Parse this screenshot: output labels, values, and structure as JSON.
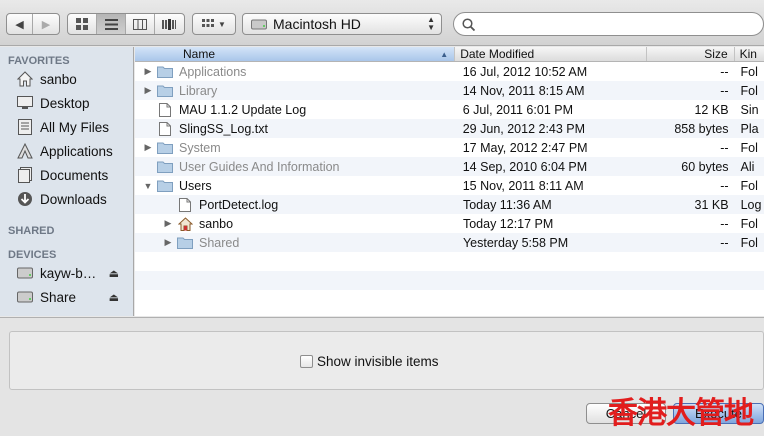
{
  "toolbar": {
    "location": "Macintosh HD",
    "search_placeholder": ""
  },
  "sidebar": {
    "favorites_header": "FAVORITES",
    "favorites": [
      {
        "label": "sanbo",
        "icon": "home-icon"
      },
      {
        "label": "Desktop",
        "icon": "desktop-icon"
      },
      {
        "label": "All My Files",
        "icon": "all-files-icon"
      },
      {
        "label": "Applications",
        "icon": "applications-icon"
      },
      {
        "label": "Documents",
        "icon": "documents-icon"
      },
      {
        "label": "Downloads",
        "icon": "downloads-icon"
      }
    ],
    "shared_header": "SHARED",
    "devices_header": "DEVICES",
    "devices": [
      {
        "label": "kayw-b…",
        "icon": "disk-icon"
      },
      {
        "label": "Share",
        "icon": "disk-icon"
      }
    ]
  },
  "columns": {
    "name": "Name",
    "date": "Date Modified",
    "size": "Size",
    "kind": "Kin"
  },
  "files": [
    {
      "name": "Applications",
      "date": "16 Jul, 2012 10:52 AM",
      "size": "--",
      "kind": "Fol",
      "dim": true,
      "tri": "▶",
      "icon": "folder",
      "indent": 0
    },
    {
      "name": "Library",
      "date": "14 Nov, 2011 8:15 AM",
      "size": "--",
      "kind": "Fol",
      "dim": true,
      "tri": "▶",
      "icon": "folder",
      "indent": 0
    },
    {
      "name": "MAU 1.1.2 Update Log",
      "date": "6 Jul, 2011 6:01 PM",
      "size": "12 KB",
      "kind": "Sin",
      "dim": false,
      "tri": "",
      "icon": "doc",
      "indent": 0
    },
    {
      "name": "SlingSS_Log.txt",
      "date": "29 Jun, 2012 2:43 PM",
      "size": "858 bytes",
      "kind": "Pla",
      "dim": false,
      "tri": "",
      "icon": "doc",
      "indent": 0
    },
    {
      "name": "System",
      "date": "17 May, 2012 2:47 PM",
      "size": "--",
      "kind": "Fol",
      "dim": true,
      "tri": "▶",
      "icon": "folder",
      "indent": 0
    },
    {
      "name": "User Guides And Information",
      "date": "14 Sep, 2010 6:04 PM",
      "size": "60 bytes",
      "kind": "Ali",
      "dim": true,
      "tri": "",
      "icon": "folder",
      "indent": 0
    },
    {
      "name": "Users",
      "date": "15 Nov, 2011 8:11 AM",
      "size": "--",
      "kind": "Fol",
      "dim": false,
      "tri": "▼",
      "icon": "folder",
      "indent": 0
    },
    {
      "name": "PortDetect.log",
      "date": "Today 11:36 AM",
      "size": "31 KB",
      "kind": "Log",
      "dim": false,
      "tri": "",
      "icon": "doc",
      "indent": 1
    },
    {
      "name": "sanbo",
      "date": "Today 12:17 PM",
      "size": "--",
      "kind": "Fol",
      "dim": false,
      "tri": "▶",
      "icon": "home",
      "indent": 1
    },
    {
      "name": "Shared",
      "date": "Yesterday 5:58 PM",
      "size": "--",
      "kind": "Fol",
      "dim": true,
      "tri": "▶",
      "icon": "folder",
      "indent": 1
    }
  ],
  "options": {
    "show_invisible": "Show invisible items"
  },
  "buttons": {
    "cancel": "Cancel",
    "execute": "Execute"
  },
  "watermark": "香港大管地",
  "colors": {
    "accent": "#7fa6de",
    "sidebar_bg": "#dde4ec",
    "watermark": "#e21d1d"
  }
}
